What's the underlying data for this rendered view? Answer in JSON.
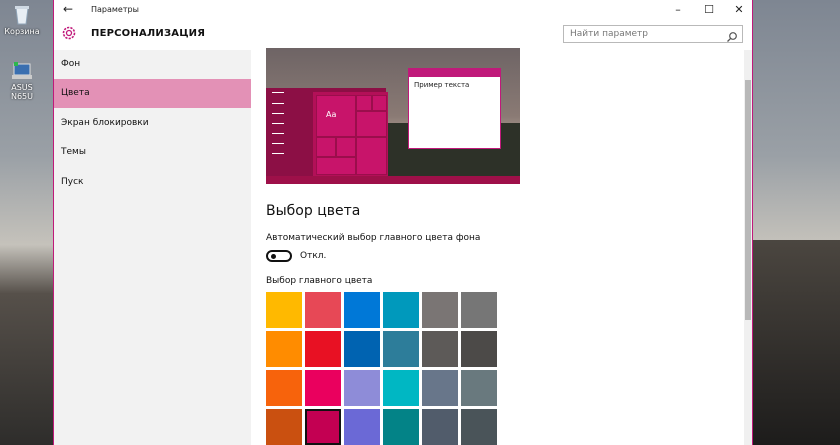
{
  "desktop": {
    "icons": [
      {
        "label": "Корзина",
        "icon": "recycle-bin-icon"
      },
      {
        "label": "ASUS N65U",
        "icon": "computer-icon"
      }
    ]
  },
  "window": {
    "title": "Параметры",
    "back_icon": "arrow-left-icon",
    "controls": {
      "minimize": "–",
      "maximize": "☐",
      "close": "✕"
    }
  },
  "header": {
    "title": "ПЕРСОНАЛИЗАЦИЯ",
    "icon": "gear-icon",
    "search_placeholder": "Найти параметр",
    "accent": "#c0197a"
  },
  "sidebar": {
    "items": [
      {
        "label": "Фон",
        "active": false
      },
      {
        "label": "Цвета",
        "active": true
      },
      {
        "label": "Экран блокировки",
        "active": false
      },
      {
        "label": "Темы",
        "active": false
      },
      {
        "label": "Пуск",
        "active": false
      }
    ]
  },
  "preview": {
    "window_text": "Пример текста",
    "tile_text": "Aa"
  },
  "main": {
    "heading": "Выбор цвета",
    "auto_label": "Автоматический выбор главного цвета фона",
    "toggle_state": "Откл.",
    "toggle_on": false,
    "palette_label": "Выбор главного цвета",
    "palette": [
      [
        "#ffb900",
        "#e74856",
        "#0078d7",
        "#0099bc",
        "#7a7574",
        "#767676"
      ],
      [
        "#ff8c00",
        "#e81123",
        "#0063b1",
        "#2d7d9a",
        "#5d5a58",
        "#4c4a48"
      ],
      [
        "#f7630c",
        "#ea005e",
        "#8e8cd8",
        "#00b7c3",
        "#68768a",
        "#69797e"
      ],
      [
        "#ca5010",
        "#c30052",
        "#6b69d6",
        "#038387",
        "#515c6b",
        "#4a5459"
      ]
    ],
    "selected_color": "#c30052"
  }
}
